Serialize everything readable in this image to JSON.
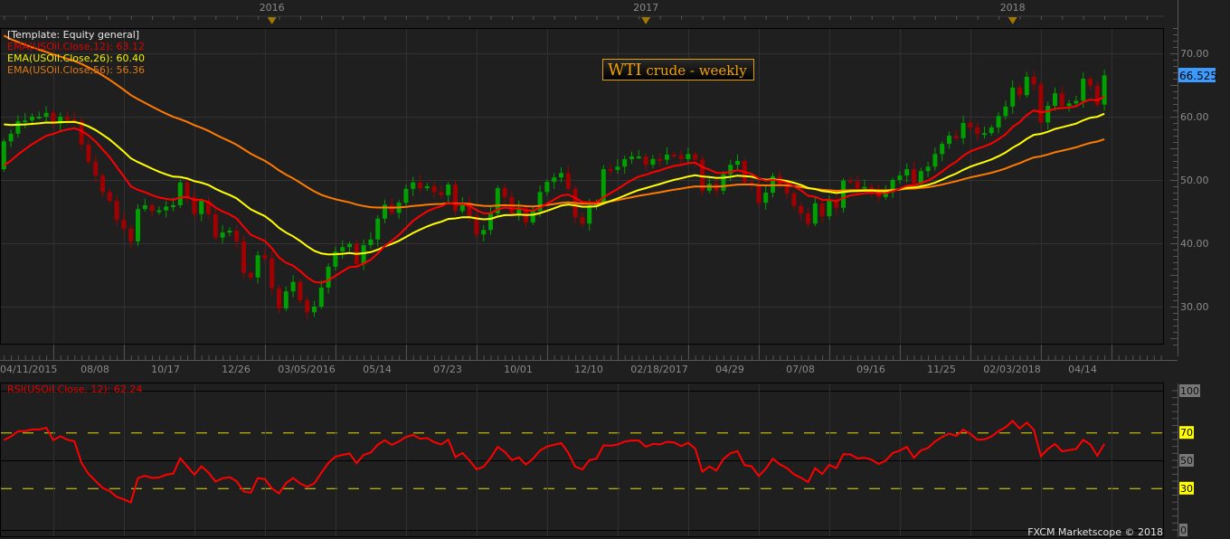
{
  "timeline": {
    "years": [
      "2016",
      "2017",
      "2018"
    ],
    "year_week_index": [
      38,
      91,
      143
    ]
  },
  "legend": {
    "template": "[Template: Equity general]",
    "ema12": "EMA(USOil.Close,12): 63.12",
    "ema26": "EMA(USOil.Close,26): 60.40",
    "ema56": "EMA(USOil.Close,56): 56.36"
  },
  "title": {
    "main": "WTI",
    "rest": " crude - weekly"
  },
  "price_axis": {
    "labels": [
      "70.00",
      "60.00",
      "50.00",
      "40.00",
      "30.00"
    ],
    "levels": [
      70,
      60,
      50,
      40,
      30
    ],
    "last_price": "66.525"
  },
  "x_axis": {
    "labels": [
      "04/11/2015",
      "08/08",
      "10/17",
      "12/26",
      "03/05/2016",
      "05/14",
      "07/23",
      "10/01",
      "12/10",
      "02/18/2017",
      "04/29",
      "07/08",
      "09/16",
      "11/25",
      "02/03/2018",
      "04/14"
    ]
  },
  "rsi": {
    "label": "RSI(USOil.Close, 12): 62.24",
    "levels": [
      "100",
      "70",
      "50",
      "30",
      "0"
    ]
  },
  "footer": {
    "copyright": "FXCM Marketscope © 2018"
  },
  "colors": {
    "up": "#00a000",
    "down": "#a00000",
    "ema12": "#ff0000",
    "ema26": "#ffff00",
    "ema56": "#ff7a00",
    "rsi": "#ff0000",
    "last_price_bg": "#3a9cff",
    "title_border": "#e0a000"
  },
  "chart_data": {
    "type": "candlestick",
    "title": "WTI crude - weekly",
    "instrument": "USOil",
    "interval": "weekly",
    "ylim": [
      24,
      74
    ],
    "first_open": 51.7,
    "closes": [
      56.1,
      57.3,
      59.3,
      59.4,
      60.0,
      60.0,
      60.6,
      58.9,
      60.0,
      59.5,
      59.3,
      55.6,
      52.9,
      50.7,
      48.1,
      46.7,
      43.7,
      42.3,
      40.3,
      45.4,
      46.0,
      45.1,
      45.2,
      45.8,
      46.0,
      49.6,
      47.3,
      44.6,
      46.7,
      44.6,
      40.9,
      41.7,
      42.0,
      40.3,
      35.3,
      34.6,
      38.1,
      37.6,
      32.9,
      29.7,
      32.4,
      33.9,
      31.0,
      29.1,
      30.0,
      33.0,
      36.3,
      38.7,
      39.4,
      39.9,
      36.7,
      39.7,
      40.6,
      43.9,
      46.1,
      44.8,
      46.4,
      48.6,
      49.6,
      48.7,
      49.0,
      48.1,
      47.6,
      49.3,
      45.1,
      46.4,
      44.3,
      41.4,
      42.1,
      44.7,
      48.7,
      47.3,
      44.7,
      45.6,
      43.3,
      45.1,
      48.1,
      49.7,
      50.4,
      51.1,
      48.6,
      44.1,
      43.1,
      46.0,
      46.5,
      51.7,
      51.6,
      52.1,
      53.3,
      53.7,
      53.7,
      52.4,
      53.3,
      53.2,
      54.0,
      53.9,
      53.3,
      54.1,
      53.2,
      48.3,
      49.4,
      48.3,
      50.9,
      52.4,
      53.0,
      49.6,
      49.3,
      46.4,
      48.0,
      50.6,
      49.0,
      47.9,
      45.9,
      44.7,
      43.1,
      46.3,
      44.3,
      46.7,
      45.6,
      49.9,
      49.8,
      48.7,
      48.9,
      48.4,
      47.3,
      48.1,
      50.0,
      50.7,
      51.7,
      49.4,
      51.4,
      52.1,
      54.1,
      55.7,
      57.0,
      56.6,
      59.0,
      58.3,
      57.3,
      57.4,
      58.3,
      60.1,
      61.6,
      64.6,
      63.4,
      66.3,
      65.1,
      59.1,
      61.7,
      63.7,
      61.7,
      62.1,
      62.5,
      66.0,
      64.9,
      61.9,
      66.525
    ],
    "ema_periods": [
      12,
      26,
      56
    ],
    "ema_seed": [
      51.6,
      59.0,
      73.4
    ],
    "ema_last": [
      63.12,
      60.4,
      56.36
    ],
    "rsi_period": 12,
    "rsi_last": 62.24,
    "rsi_levels": [
      70,
      30
    ]
  }
}
